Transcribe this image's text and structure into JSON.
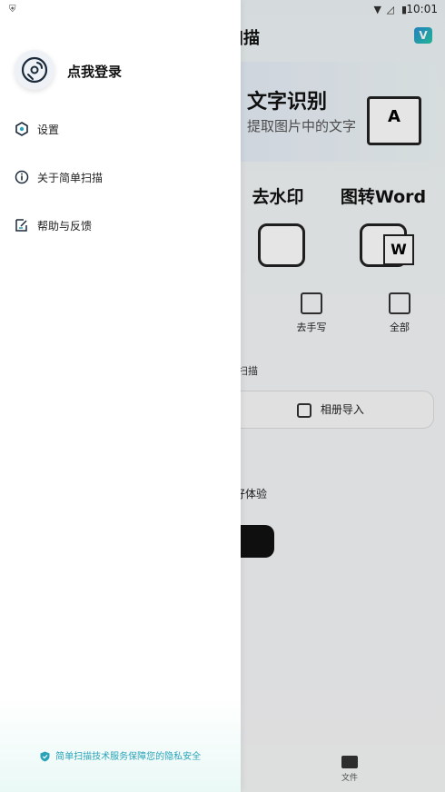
{
  "status": {
    "time": "10:01"
  },
  "app": {
    "title": "扫描",
    "vip_badge": "V",
    "ocr_card": {
      "title": "文字识别",
      "subtitle": "提取图片中的文字",
      "doc_letter": "A"
    },
    "cards": [
      {
        "title": "去水印"
      },
      {
        "title": "图转Word",
        "badge_letter": "W"
      }
    ],
    "tools": [
      {
        "label": "去手写"
      },
      {
        "label": "全部"
      }
    ],
    "section_label": "扫描",
    "album_import": "相册导入",
    "experience_text": "好体验",
    "nav": {
      "file": "文件"
    }
  },
  "drawer": {
    "login_label": "点我登录",
    "menu": [
      {
        "label": "设置",
        "icon": "settings-icon"
      },
      {
        "label": "关于简单扫描",
        "icon": "info-icon"
      },
      {
        "label": "帮助与反馈",
        "icon": "feedback-icon"
      }
    ],
    "footer": "简单扫描技术服务保障您的隐私安全"
  },
  "colors": {
    "accent": "#2aa3b8",
    "drawer_bg": "#ffffff"
  }
}
